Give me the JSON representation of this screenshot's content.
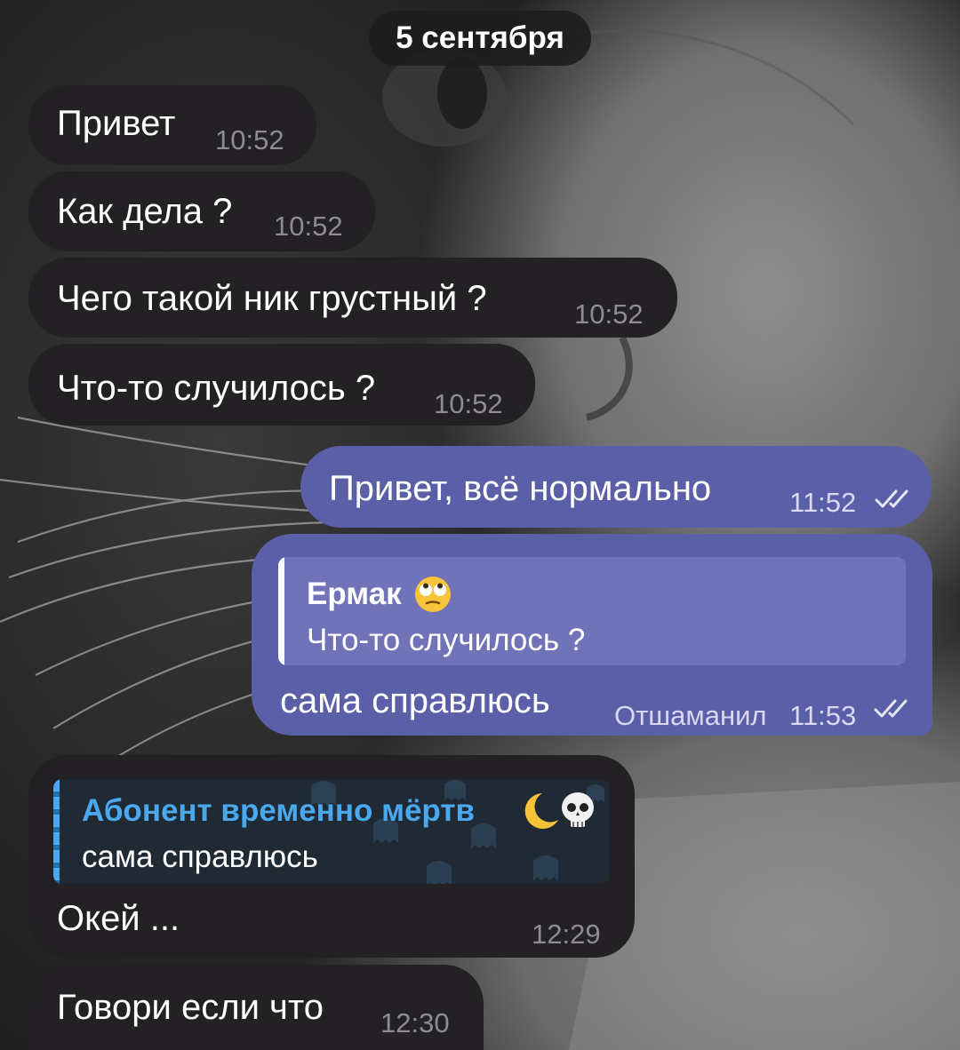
{
  "date_separator": "5 сентября",
  "messages": [
    {
      "text": "Привет",
      "time": "10:52"
    },
    {
      "text": "Как дела ?",
      "time": "10:52"
    },
    {
      "text": "Чего такой ник грустный ?",
      "time": "10:52"
    },
    {
      "text": "Что-то случилось ?",
      "time": "10:52"
    },
    {
      "text": "Привет, всё нормально",
      "time": "11:52"
    },
    {
      "reply_to": {
        "name": "Ермак",
        "emoji": "face-with-rolling-eyes-icon",
        "text": "Что-то случилось ?"
      },
      "text": "сама справлюсь",
      "edited": "Отшаманил",
      "time": "11:53"
    },
    {
      "reply_to": {
        "name": "Абонент временно мёртв",
        "emoji": "crescent-moon-and-skull-icon",
        "text": "сама справлюсь"
      },
      "text": "Окей ...",
      "time": "12:29"
    },
    {
      "text": "Говори если что",
      "time": "12:30"
    }
  ],
  "colors": {
    "incoming_bubble": "#232124",
    "outgoing_bubble": "#5a5fa8",
    "reply_accent_incoming": "#4aa8ef",
    "reply_accent_outgoing": "#ffffff"
  }
}
